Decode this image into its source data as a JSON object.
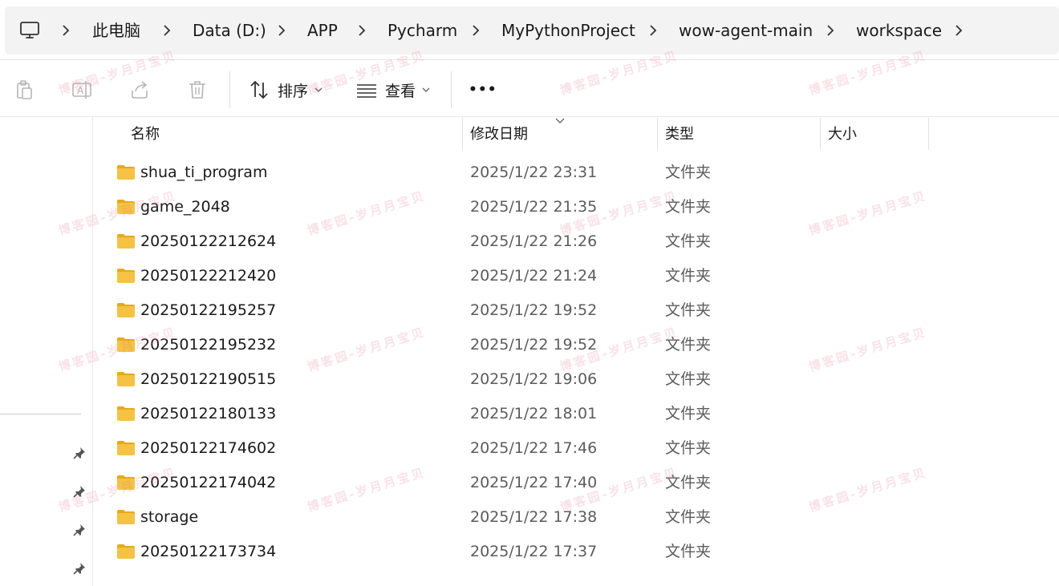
{
  "address_bar": {
    "root_icon": "computer-icon",
    "crumbs": [
      "此电脑",
      "Data (D:)",
      "APP",
      "Pycharm",
      "MyPythonProject",
      "wow-agent-main",
      "workspace"
    ]
  },
  "toolbar": {
    "icons": [
      "paste-icon",
      "rename-icon",
      "share-icon",
      "delete-icon"
    ],
    "sort_label": "排序",
    "view_label": "查看",
    "more_label": "•••"
  },
  "columns": {
    "name": "名称",
    "modified": "修改日期",
    "type": "类型",
    "size": "大小"
  },
  "files": [
    {
      "name": "shua_ti_program",
      "modified": "2025/1/22 23:31",
      "type": "文件夹",
      "size": ""
    },
    {
      "name": "game_2048",
      "modified": "2025/1/22 21:35",
      "type": "文件夹",
      "size": ""
    },
    {
      "name": "20250122212624",
      "modified": "2025/1/22 21:26",
      "type": "文件夹",
      "size": ""
    },
    {
      "name": "20250122212420",
      "modified": "2025/1/22 21:24",
      "type": "文件夹",
      "size": ""
    },
    {
      "name": "20250122195257",
      "modified": "2025/1/22 19:52",
      "type": "文件夹",
      "size": ""
    },
    {
      "name": "20250122195232",
      "modified": "2025/1/22 19:52",
      "type": "文件夹",
      "size": ""
    },
    {
      "name": "20250122190515",
      "modified": "2025/1/22 19:06",
      "type": "文件夹",
      "size": ""
    },
    {
      "name": "20250122180133",
      "modified": "2025/1/22 18:01",
      "type": "文件夹",
      "size": ""
    },
    {
      "name": "20250122174602",
      "modified": "2025/1/22 17:46",
      "type": "文件夹",
      "size": ""
    },
    {
      "name": "20250122174042",
      "modified": "2025/1/22 17:40",
      "type": "文件夹",
      "size": ""
    },
    {
      "name": "storage",
      "modified": "2025/1/22 17:38",
      "type": "文件夹",
      "size": ""
    },
    {
      "name": "20250122173734",
      "modified": "2025/1/22 17:37",
      "type": "文件夹",
      "size": ""
    }
  ],
  "watermark": "博客园-岁月月宝贝",
  "colors": {
    "folder": "#f5c242",
    "folder_dark": "#e8a917",
    "secondary_text": "#5c5c5c"
  }
}
